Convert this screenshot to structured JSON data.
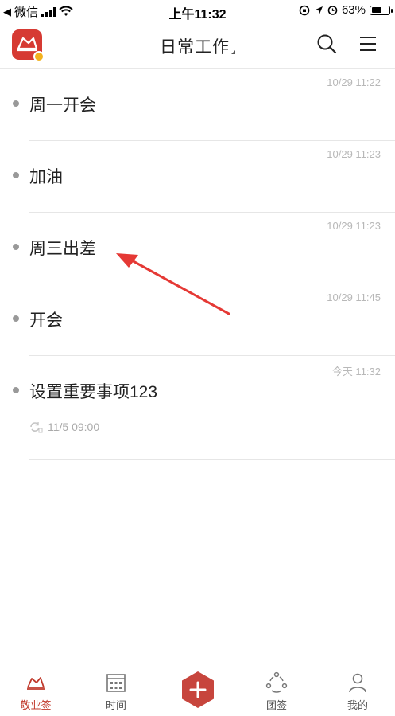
{
  "status_bar": {
    "carrier": "微信",
    "time": "上午11:32",
    "battery": "63%",
    "battery_level": 0.63
  },
  "header": {
    "title": "日常工作"
  },
  "notes": [
    {
      "time": "10/29 11:22",
      "title": "周一开会"
    },
    {
      "time": "10/29 11:23",
      "title": "加油"
    },
    {
      "time": "10/29 11:23",
      "title": "周三出差"
    },
    {
      "time": "10/29 11:45",
      "title": "开会"
    },
    {
      "time": "今天 11:32",
      "title": "设置重要事项123",
      "reminder": "11/5 09:00"
    }
  ],
  "tabbar": {
    "tabs": [
      {
        "label": "敬业签",
        "icon": "note-icon",
        "active": true
      },
      {
        "label": "时间",
        "icon": "calendar-icon",
        "active": false
      },
      {
        "label": "团签",
        "icon": "team-icon",
        "active": false
      },
      {
        "label": "我的",
        "icon": "profile-icon",
        "active": false
      }
    ]
  },
  "colors": {
    "brand": "#d63a33",
    "annotation": "#e53935"
  }
}
